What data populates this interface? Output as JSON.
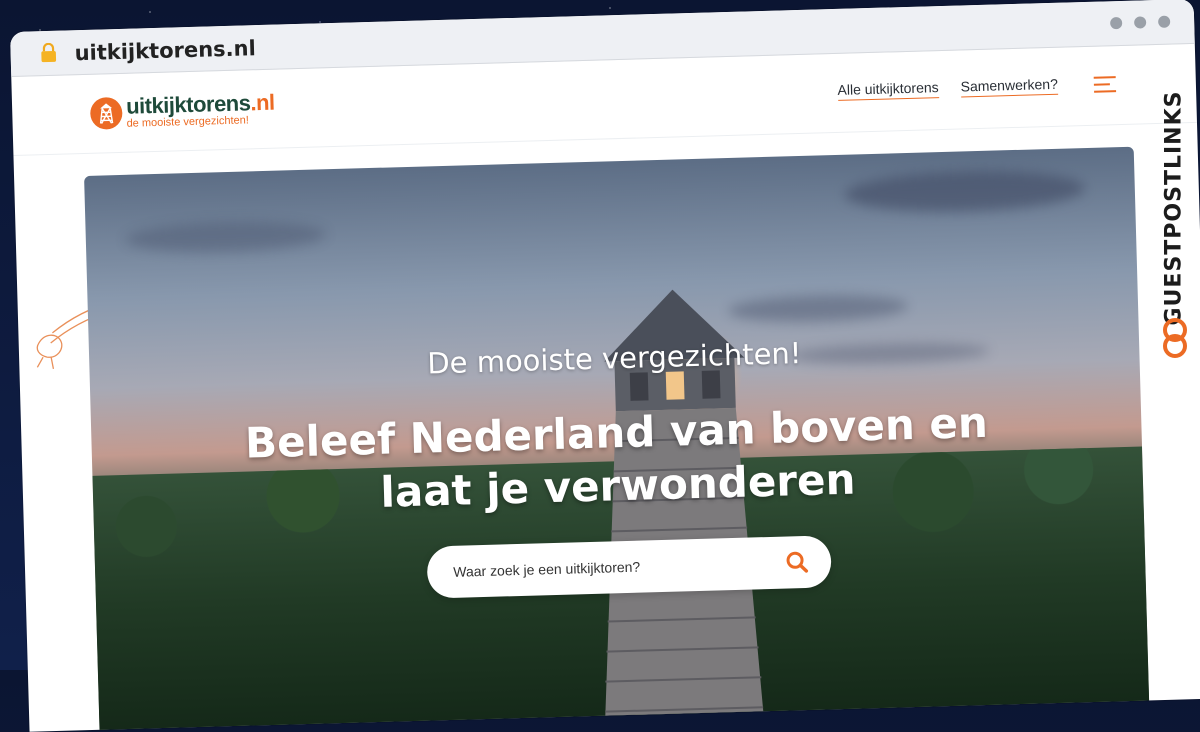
{
  "browser": {
    "url": "uitkijktorens.nl",
    "lock_icon": "lock-icon"
  },
  "site": {
    "logo": {
      "name_main": "uitkijktorens",
      "name_tld": ".nl",
      "tagline": "de mooiste vergezichten!"
    },
    "nav": {
      "items": [
        "Alle uitkijktorens",
        "Samenwerken?"
      ],
      "menu_icon": "hamburger-menu-icon"
    }
  },
  "hero": {
    "subtitle": "De mooiste vergezichten!",
    "title": "Beleef Nederland van boven en laat je verwonderen",
    "search": {
      "placeholder": "Waar zoek je een uitkijktoren?",
      "icon": "search-icon"
    }
  },
  "watermark": {
    "text": "GUESTPOSTLINKS"
  },
  "colors": {
    "accent": "#ec6b24",
    "logo_green": "#1e4a3a",
    "background": "#0d1b3a"
  }
}
